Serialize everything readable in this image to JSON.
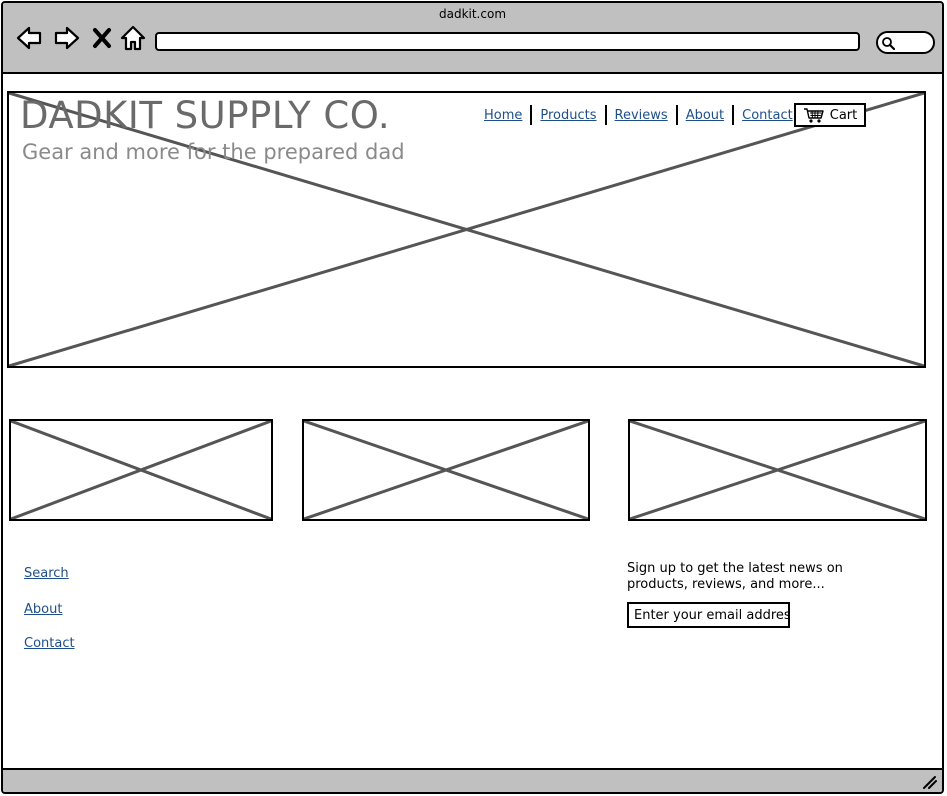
{
  "browser": {
    "title": "dadkit.com",
    "back_icon": "back-arrow-icon",
    "forward_icon": "forward-arrow-icon",
    "stop_icon": "close-x-icon",
    "home_icon": "home-icon",
    "search_icon": "search-icon",
    "url": ""
  },
  "header": {
    "brand": "DADKIT SUPPLY CO.",
    "tagline": "Gear and more for the prepared dad"
  },
  "nav": {
    "items": [
      {
        "label": "Home"
      },
      {
        "label": "Products"
      },
      {
        "label": "Reviews"
      },
      {
        "label": "About"
      },
      {
        "label": "Contact"
      }
    ],
    "cart_label": "Cart",
    "cart_icon": "shopping-cart-icon"
  },
  "footer": {
    "links": [
      {
        "label": "Search"
      },
      {
        "label": "About"
      },
      {
        "label": "Contact"
      }
    ],
    "signup_text": "Sign up to get the latest news on products, reviews, and more...",
    "email_placeholder": "Enter your email address"
  },
  "colors": {
    "chrome": "#c0c0c0",
    "link": "#1f4f8a",
    "brand_text": "#6a6a6a",
    "placeholder_stroke": "#555555"
  }
}
